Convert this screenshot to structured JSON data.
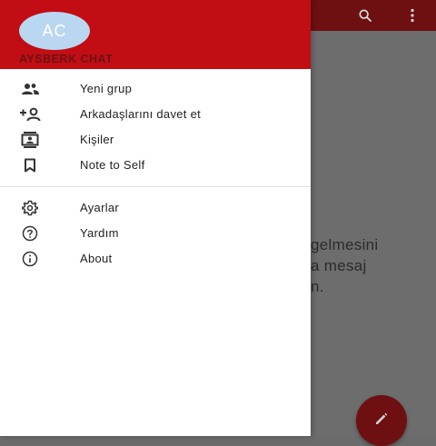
{
  "app_bar": {
    "search_icon": "search-icon",
    "more_icon": "more-vert-icon"
  },
  "background": {
    "lines": [
      "gelmesini",
      "a mesaj",
      "n."
    ],
    "fab_icon": "pencil-icon"
  },
  "drawer": {
    "avatar_initials": "AC",
    "account_name": "AYSBERK CHAT",
    "items": [
      {
        "label": "Yeni grup",
        "icon": "group-icon"
      },
      {
        "label": "Arkadaşlarını davet et",
        "icon": "invite-person-icon"
      },
      {
        "label": "Kişiler",
        "icon": "contacts-icon"
      },
      {
        "label": "Note to Self",
        "icon": "bookmark-icon"
      }
    ],
    "items2": [
      {
        "label": "Ayarlar",
        "icon": "settings-icon"
      },
      {
        "label": "Yardım",
        "icon": "help-icon"
      },
      {
        "label": "About",
        "icon": "info-icon"
      }
    ]
  },
  "colors": {
    "header": "#c20d14",
    "avatar": "#b9d7f0",
    "app_bar_dim": "#6e0f12"
  }
}
